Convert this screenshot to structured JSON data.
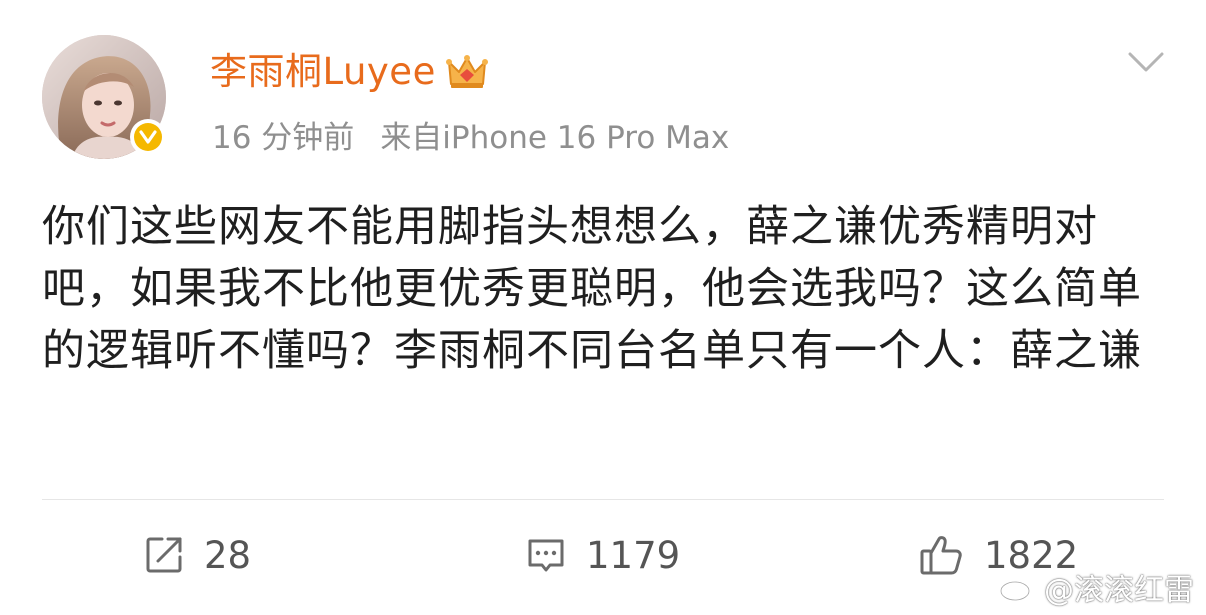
{
  "colors": {
    "username": "#e86b1c",
    "verified": "#f5b800",
    "meta_text": "#8f8f8f",
    "body_text": "#1f1f1f",
    "action_text": "#555555"
  },
  "header": {
    "username": "李雨桐Luyee",
    "badge_icon": "crown-icon",
    "verified_icon": "verified-v-icon",
    "time": "16 分钟前",
    "source": "来自iPhone 16 Pro Max",
    "more_icon": "chevron-down-icon"
  },
  "post": {
    "text": "你们这些网友不能用脚指头想想么，薛之谦优秀精明对吧，如果我不比他更优秀更聪明，他会选我吗？这么简单的逻辑听不懂吗？李雨桐不同台名单只有一个人：薛之谦"
  },
  "actions": {
    "repost": {
      "icon": "repost-icon",
      "count": "28"
    },
    "comment": {
      "icon": "comment-icon",
      "count": "1179"
    },
    "like": {
      "icon": "thumbs-up-icon",
      "count": "1822"
    }
  },
  "watermark": {
    "icon": "weibo-logo-icon",
    "text": "@滚滚红雷"
  }
}
